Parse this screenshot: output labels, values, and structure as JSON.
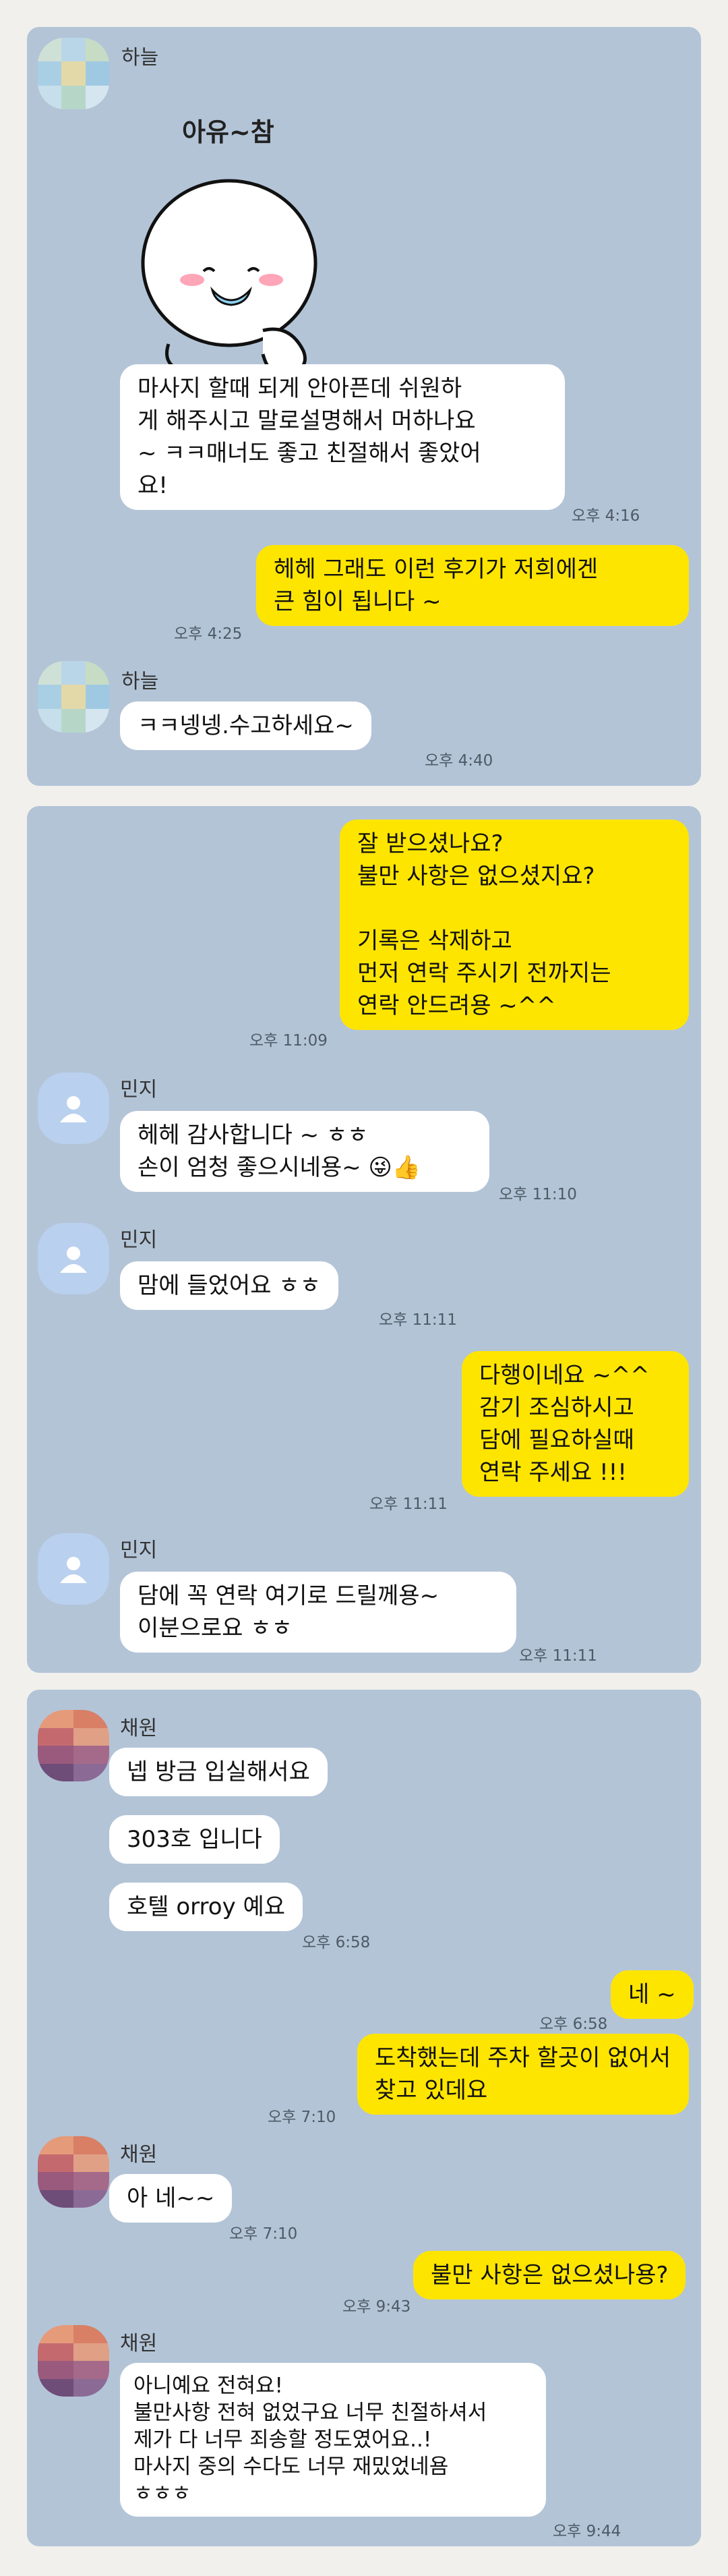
{
  "colors": {
    "panel": "#b3c4d7",
    "mine": "#fee500",
    "theirs": "#ffffff",
    "page": "#f1f0ec"
  },
  "panel1": {
    "sender1": "하늘",
    "sticker_text": "아유~참",
    "msg1": "마사지 할때 되게 안아픈데 쉬원하\n게 해주시고 말로설명해서 머하나요\n~ ㅋㅋ매너도 좋고 친절해서 좋았어\n요!",
    "time1": "오후 4:16",
    "my_msg1": "헤헤 그래도 이런 후기가 저희에겐\n큰 힘이 됩니다 ~",
    "my_time1": "오후 4:25",
    "sender2": "하늘",
    "msg2": "ㅋㅋ넹넹.수고하세요~",
    "time2": "오후 4:40"
  },
  "panel2": {
    "my_msg1": "잘 받으셨나요?\n불만 사항은 없으셨지요?\n\n기록은 삭제하고\n먼저 연락 주시기 전까지는\n연락 안드려용 ~^^",
    "my_time1": "오후 11:09",
    "sender1": "민지",
    "msg1": "헤헤 감사합니다 ~ ㅎㅎ\n손이 엄청 좋으시네용~ 😜👍",
    "time1": "오후 11:10",
    "sender2": "민지",
    "msg2": "맘에 들었어요 ㅎㅎ",
    "time2": "오후 11:11",
    "my_msg2": "다행이네요 ~^^\n감기 조심하시고\n담에 필요하실때\n연락 주세요 !!!",
    "my_time2": "오후 11:11",
    "sender3": "민지",
    "msg3": "담에 꼭 연락 여기로 드릴께용~\n이분으로요 ㅎㅎ",
    "time3": "오후 11:11"
  },
  "panel3": {
    "sender1": "채원",
    "msg1": "넵 방금 입실해서요",
    "msg2": "303호 입니다",
    "msg3": "호텔 orroy 예요",
    "time1": "오후 6:58",
    "my_msg1": "네 ~",
    "my_time1": "오후 6:58",
    "my_msg2": "도착했는데  주차 할곳이 없어서\n찾고 있데요",
    "my_time2": "오후 7:10",
    "sender2": "채원",
    "msg4": "아 네~~",
    "time2": "오후 7:10",
    "my_msg3": "불만 사항은 없으셨나용?",
    "my_time3": "오후 9:43",
    "sender3": "채원",
    "msg5": "아니예요 전혀요!\n불만사항 전혀 없었구요 너무 친절하셔서\n제가 다 너무 죄송할 정도였어요..!\n마사지 중의 수다도 너무 재밌었네욤\nㅎㅎㅎ",
    "time3": "오후 9:44"
  }
}
